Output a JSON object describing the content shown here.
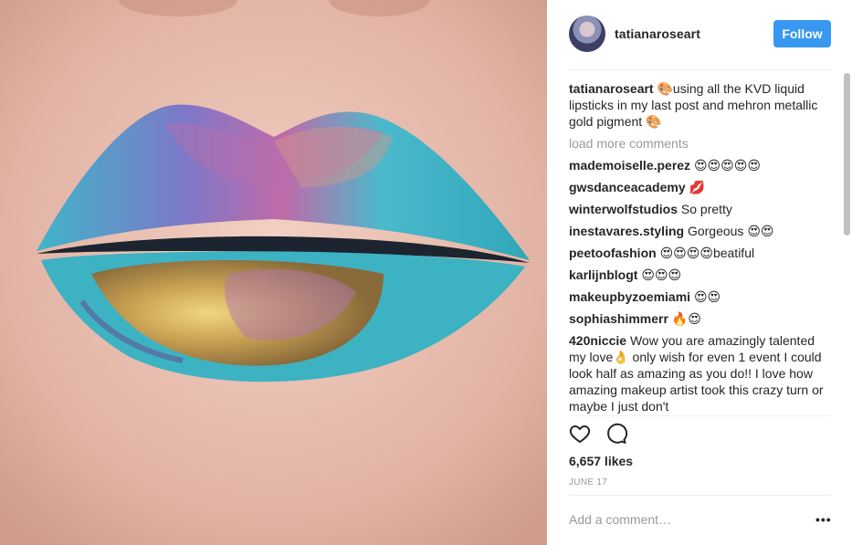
{
  "post": {
    "username": "tatianaroseart",
    "follow_label": "Follow",
    "caption": "🎨using all the KVD liquid lipsticks in my last post and mehron metallic gold pigment 🎨",
    "load_more": "load more comments",
    "comments": [
      {
        "user": "mademoiselle.perez",
        "text": "😍😍😍😍😍"
      },
      {
        "user": "gwsdanceacademy",
        "text": "💋"
      },
      {
        "user": "winterwolfstudios",
        "text": "So pretty"
      },
      {
        "user": "inestavares.styling",
        "text": "Gorgeous 😍😍"
      },
      {
        "user": "peetoofashion",
        "text": "😍😍😍😍beatiful"
      },
      {
        "user": "karlijnblogt",
        "text": "😍😍😍"
      },
      {
        "user": "makeupbyzoemiami",
        "text": "😍😍"
      },
      {
        "user": "sophiashimmerr",
        "text": "🔥😍"
      },
      {
        "user": "420niccie",
        "text": "Wow you are amazingly talented my love👌 only wish for even 1 event I could look half as amazing as you do!! I love how amazing makeup artist took this crazy turn or maybe I just don't"
      }
    ],
    "likes": "6,657 likes",
    "date": "JUNE 17",
    "add_comment_placeholder": "Add a comment…",
    "more_label": "•••"
  },
  "icons": {
    "like": "heart-icon",
    "comment": "speech-bubble-icon"
  },
  "colors": {
    "follow_bg": "#3897f0",
    "muted_text": "#999999",
    "lip_teal": "#3fb8c9",
    "lip_gold": "#d8b357"
  }
}
